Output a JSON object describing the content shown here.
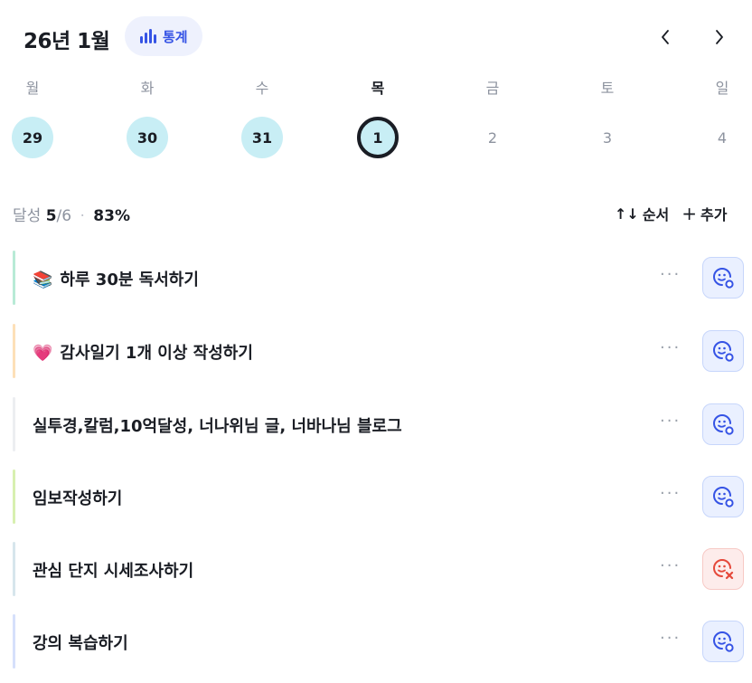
{
  "header": {
    "title": "26년 1월",
    "stats_label": "통계",
    "prev_icon": "chevron-left-icon",
    "next_icon": "chevron-right-icon"
  },
  "week": [
    {
      "name": "월",
      "num": "29",
      "state": "done"
    },
    {
      "name": "화",
      "num": "30",
      "state": "done"
    },
    {
      "name": "수",
      "num": "31",
      "state": "done"
    },
    {
      "name": "목",
      "num": "1",
      "state": "today"
    },
    {
      "name": "금",
      "num": "2",
      "state": "future"
    },
    {
      "name": "토",
      "num": "3",
      "state": "future"
    },
    {
      "name": "일",
      "num": "4",
      "state": "future"
    }
  ],
  "summary": {
    "label": "달성",
    "done": "5",
    "total": "/6",
    "sep": "·",
    "percent": "83%"
  },
  "actions": {
    "sort_icon": "↑↓",
    "sort_label": "순서",
    "add_icon": "+",
    "add_label": "추가"
  },
  "tasks": [
    {
      "emoji": "📚",
      "text": "하루 30분 독서하기",
      "bar_color": "#b8ead6",
      "status": "ok",
      "more": "···"
    },
    {
      "emoji": "💗",
      "text": "감사일기 1개 이상 작성하기",
      "bar_color": "#fde0b8",
      "status": "ok",
      "more": "···"
    },
    {
      "emoji": "",
      "text": "실투경,칼럼,10억달성, 너나위님 글, 너바나님 블로그",
      "bar_color": "#eceef1",
      "status": "ok",
      "more": "···"
    },
    {
      "emoji": "",
      "text": "임보작성하기",
      "bar_color": "#d8f0b0",
      "status": "ok",
      "more": "···"
    },
    {
      "emoji": "",
      "text": "관심 단지 시세조사하기",
      "bar_color": "#d7e6ec",
      "status": "fail",
      "more": "···"
    },
    {
      "emoji": "",
      "text": "강의 복습하기",
      "bar_color": "#d6e0fb",
      "status": "ok",
      "more": "···"
    }
  ],
  "colors": {
    "accent": "#3553e5",
    "ok_face": "#3553e5",
    "fail_face": "#e5483a",
    "done_day": "#c8eef5"
  }
}
